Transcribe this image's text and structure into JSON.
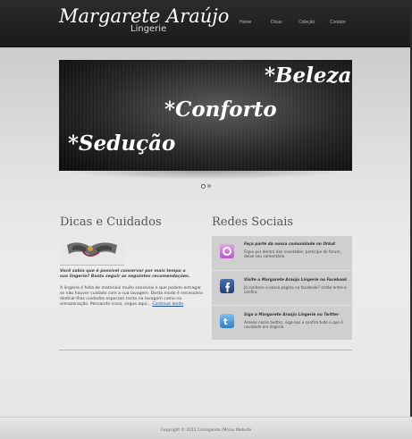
{
  "header": {
    "logo_main": "Margarete Araújo",
    "logo_sub": "Lingerie",
    "nav": [
      "Home",
      "Dicas",
      "Coleção",
      "Contato"
    ]
  },
  "slider": {
    "words": [
      "*Beleza",
      "*Conforto",
      "*Sedução"
    ],
    "dots": 2,
    "active_dot": 1
  },
  "tips": {
    "title": "Dicas e Cuidados",
    "question": "Você sabia que é possível conservar por mais tempo a sua lingerie? Basta seguir as seguintes recomendações.",
    "text": "A lingerie é feita de materiais muito sensíveis e que podem estragar se não houver cuidado com a sua lavagem. Desta modo é necessário dedicar-lhas cuidados especiais tanto na lavagem como na armazenação. Pensando nisso, segue aqui...",
    "link": "Continue lendo"
  },
  "social": {
    "title": "Redes Sociais",
    "items": [
      {
        "icon": "orkut-icon",
        "title": "Faça parte da nossa comunidade no Orkut",
        "desc": "Fique por dentro das novidades, participe do forum, deixe seu comentário.",
        "color": "#c86bd6"
      },
      {
        "icon": "facebook-icon",
        "title": "Visite a Margarete Araújo Lingerie no Facebook",
        "desc": "Já conhece a nossa página no facebook? então entre e confira.",
        "color": "#2b4f8f"
      },
      {
        "icon": "twitter-icon",
        "title": "Siga a Margarete Araújo Lingerie no Twitter",
        "desc": "Acesse nosso twitter, siga-nos e confira tudo o que é novidade em lingerie.",
        "color": "#3d8fd6"
      }
    ]
  },
  "footer": {
    "text": "Copyright © 2011 Carregando (Minas Website"
  }
}
